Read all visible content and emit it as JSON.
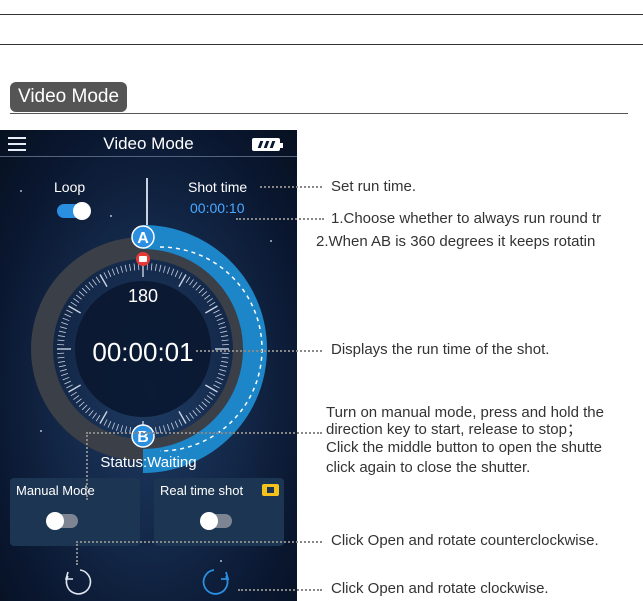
{
  "section": {
    "tag": "Video Mode"
  },
  "app": {
    "title": "Video Mode",
    "loop_label": "Loop",
    "shot_time_label": "Shot time",
    "shot_time_value": "00:00:10",
    "point_a": "A",
    "point_b": "B",
    "angle": "180",
    "elapsed": "00:00:01",
    "status": "Status:Waiting",
    "manual_mode_label": "Manual Mode",
    "real_time_shot_label": "Real time shot",
    "loop_enabled": true,
    "manual_mode_enabled": false,
    "real_time_shot_enabled": false,
    "colors": {
      "accent": "#2a8fe0",
      "shot_time": "#4aa8ff",
      "arc": "#1d86c8",
      "camera": "#f4c21b"
    }
  },
  "annotations": {
    "set_run_time": "Set run time.",
    "ab_line1": "1.Choose whether to always run round tr",
    "ab_line2": "2.When AB is 360 degrees it keeps rotatin",
    "run_time": "Displays the run time of the shot.",
    "manual_line1": "Turn on manual mode, press and hold the",
    "manual_line2": "direction key to start, release to stop；",
    "manual_line3": "Click the middle button to open the shutte",
    "manual_line4": "click again to close the shutter.",
    "ccw": "Click Open and rotate counterclockwise.",
    "cw": "Click Open and rotate clockwise."
  }
}
